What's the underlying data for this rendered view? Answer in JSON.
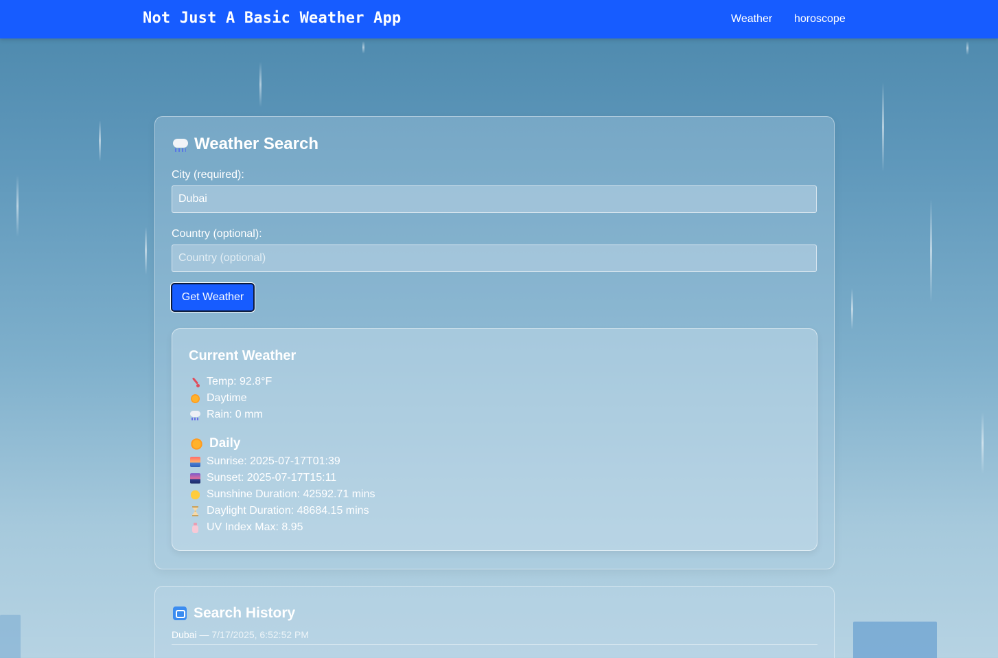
{
  "nav": {
    "brand": "Not Just A Basic Weather App",
    "links": [
      "Weather",
      "horoscope"
    ]
  },
  "search": {
    "title": "Weather Search",
    "title_icon": "cloud-rain-icon",
    "city_label": "City (required):",
    "city_value": "Dubai",
    "country_label": "Country (optional):",
    "country_placeholder": "Country (optional)",
    "button_label": "Get Weather"
  },
  "current": {
    "title": "Current Weather",
    "items": [
      {
        "icon": "thermometer-icon",
        "text": "Temp: 92.8°F"
      },
      {
        "icon": "sun-icon",
        "text": "Daytime"
      },
      {
        "icon": "cloud-rain-icon",
        "text": "Rain: 0 mm"
      }
    ]
  },
  "daily": {
    "title": "Daily",
    "items": [
      {
        "icon": "sunrise-icon",
        "text": "Sunrise: 2025-07-17T01:39"
      },
      {
        "icon": "sunset-icon",
        "text": "Sunset: 2025-07-17T15:11"
      },
      {
        "icon": "smiling-face-icon",
        "text": "Sunshine Duration: 42592.71 mins"
      },
      {
        "icon": "hourglass-icon",
        "text": "Daylight Duration: 48684.15 mins"
      },
      {
        "icon": "lotion-bottle-icon",
        "text": "UV Index Max: 8.95"
      }
    ]
  },
  "history": {
    "title": "Search History",
    "entries": [
      {
        "city": "Dubai",
        "separator": "—",
        "time": "7/17/2025, 6:52:52 PM"
      }
    ]
  },
  "colors": {
    "accent": "#175cff",
    "background_top": "#4b87ab",
    "background_bottom": "#b6d3e3"
  }
}
